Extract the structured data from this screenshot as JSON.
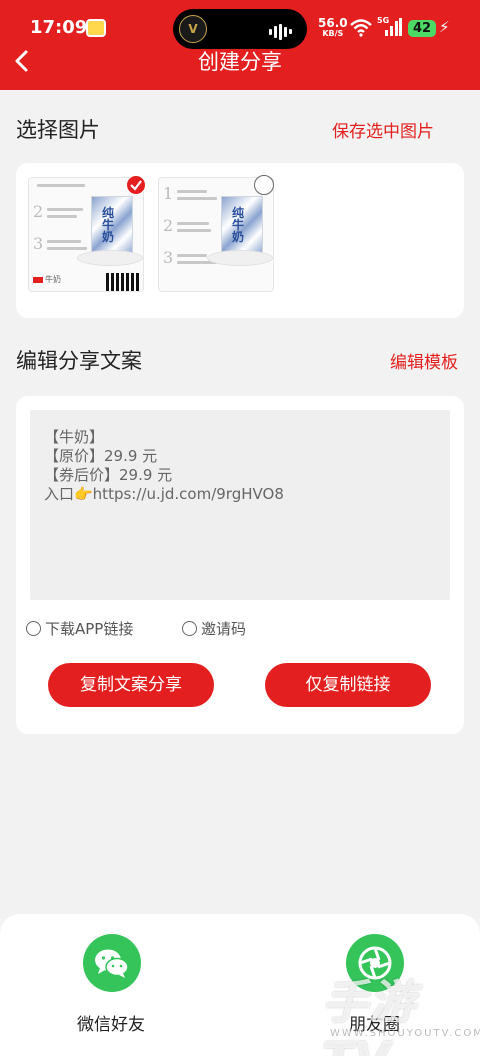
{
  "status_bar": {
    "time": "17:09",
    "net_speed": "56.0",
    "net_unit": "KB/S",
    "network": "5G",
    "battery": "42",
    "island_logo": "V"
  },
  "header": {
    "title": "创建分享",
    "background": "#e3201f"
  },
  "select_images": {
    "title": "选择图片",
    "save_link": "保存选中图片",
    "images": [
      {
        "selected": true,
        "product_title": "纯牛奶",
        "store_tag": "牛奶"
      },
      {
        "selected": false,
        "product_title": "纯牛奶",
        "store_tag": ""
      }
    ]
  },
  "edit_copy": {
    "title": "编辑分享文案",
    "template_link": "编辑模板",
    "lines": [
      "【牛奶】",
      "【原价】29.9 元",
      "【券后价】29.9 元",
      "入口👉https://u.jd.com/9rgHVO8"
    ],
    "options": {
      "download_app": "下载APP链接",
      "invite_code": "邀请码"
    },
    "buttons": {
      "copy_share": "复制文案分享",
      "copy_link": "仅复制链接"
    }
  },
  "share_sheet": {
    "wechat_friend": "微信好友",
    "moments": "朋友圈"
  },
  "watermark": {
    "main": "手游TV",
    "sub": "WWW.SHOUYOUTV.COM"
  },
  "colors": {
    "accent": "#e3201f",
    "wechat_green": "#34c45a"
  }
}
